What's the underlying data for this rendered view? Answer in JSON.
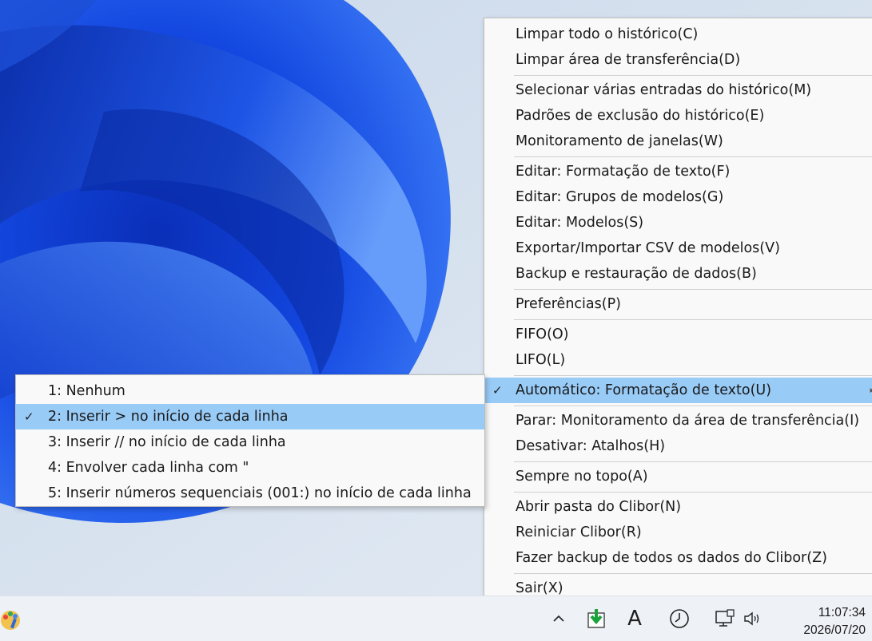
{
  "main_menu": {
    "groups": [
      {
        "items": [
          {
            "label": "Limpar todo o histórico(C)"
          },
          {
            "label": "Limpar área de transferência(D)"
          }
        ]
      },
      {
        "items": [
          {
            "label": "Selecionar várias entradas do histórico(M)"
          },
          {
            "label": "Padrões de exclusão do histórico(E)"
          },
          {
            "label": "Monitoramento de janelas(W)"
          }
        ]
      },
      {
        "items": [
          {
            "label": "Editar: Formatação de texto(F)"
          },
          {
            "label": "Editar: Grupos de modelos(G)"
          },
          {
            "label": "Editar: Modelos(S)"
          },
          {
            "label": "Exportar/Importar CSV de modelos(V)"
          },
          {
            "label": "Backup e restauração de dados(B)"
          }
        ]
      },
      {
        "items": [
          {
            "label": "Preferências(P)"
          }
        ]
      },
      {
        "items": [
          {
            "label": "FIFO(O)"
          },
          {
            "label": "LIFO(L)"
          }
        ]
      },
      {
        "items": [
          {
            "label": "Automático: Formatação de texto(U)",
            "checked": true,
            "highlighted": true,
            "submenu": true
          }
        ]
      },
      {
        "items": [
          {
            "label": "Parar: Monitoramento da área de transferência(I)"
          },
          {
            "label": "Desativar: Atalhos(H)"
          }
        ]
      },
      {
        "items": [
          {
            "label": "Sempre no topo(A)"
          }
        ]
      },
      {
        "items": [
          {
            "label": "Abrir pasta do Clibor(N)"
          },
          {
            "label": "Reiniciar Clibor(R)"
          },
          {
            "label": "Fazer backup de todos os dados do Clibor(Z)"
          }
        ]
      },
      {
        "items": [
          {
            "label": "Sair(X)"
          }
        ]
      }
    ]
  },
  "submenu": {
    "items": [
      {
        "label": "1: Nenhum"
      },
      {
        "label": "2: Inserir > no início de cada linha",
        "checked": true,
        "highlighted": true
      },
      {
        "label": "3: Inserir // no início de cada linha"
      },
      {
        "label": "4: Envolver cada linha com \""
      },
      {
        "label": "5: Inserir números sequenciais (001:) no início de cada linha"
      }
    ]
  },
  "glyphs": {
    "check": "✓",
    "submenu_arrow": "▸"
  },
  "taskbar": {
    "icons": [
      "paint-app-icon",
      "show-hidden-icons-chevron",
      "clibor-download-icon",
      "input-method-A-icon",
      "clock-app-icon",
      "network-icon",
      "volume-icon"
    ],
    "ime_label": "A",
    "time": "11:07:34",
    "date": "2026/07/20"
  },
  "colors": {
    "highlight": "#99cbf7",
    "menu_bg": "#f9f9f9",
    "wallpaper_accent": "#1f56e6"
  }
}
